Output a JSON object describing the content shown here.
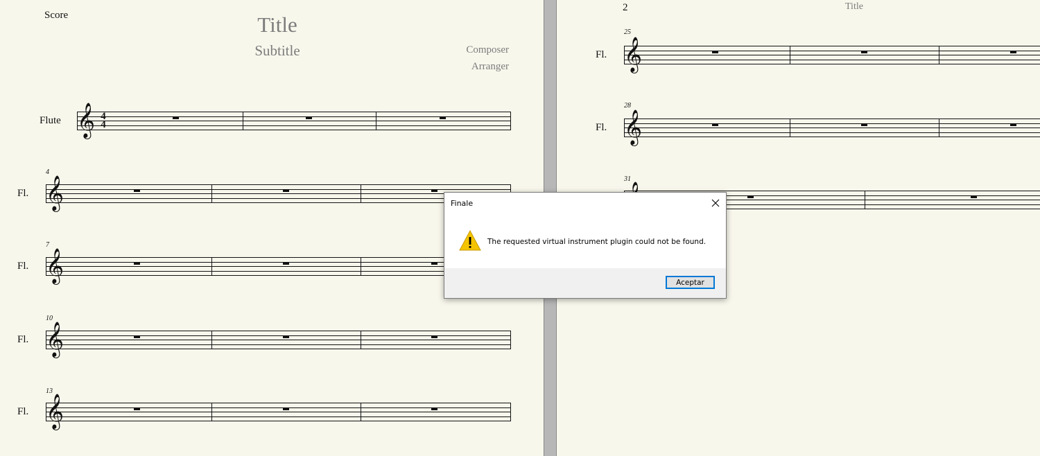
{
  "score": {
    "label": "Score",
    "title": "Title",
    "subtitle": "Subtitle",
    "composer": "Composer",
    "arranger": "Arranger",
    "first_instrument": "Flute",
    "staff_abbrev": "Fl.",
    "time_signature": {
      "top": "4",
      "bottom": "4"
    },
    "left_measure_numbers": [
      "4",
      "7",
      "10",
      "13"
    ],
    "page2_number": "2",
    "page2_running_title": "Title",
    "right_measure_numbers": [
      "25",
      "28",
      "31"
    ]
  },
  "dialog": {
    "title": "Finale",
    "message": "The requested virtual instrument plugin could not be found.",
    "ok_label": "Aceptar",
    "icon": "warning-icon",
    "warning_color": "#f5c400"
  }
}
